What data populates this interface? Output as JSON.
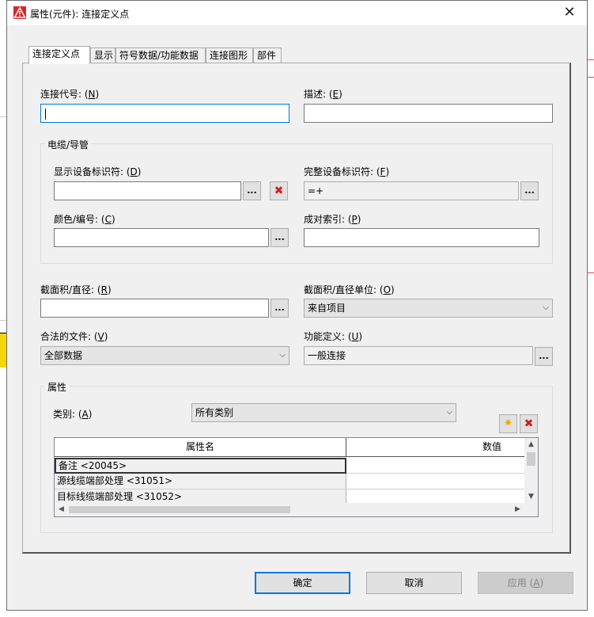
{
  "window": {
    "title": "属性(元件): 连接定义点",
    "close_glyph": "✕"
  },
  "tabs": [
    {
      "label": "连接定义点",
      "active": true
    },
    {
      "label": "显示"
    },
    {
      "label": "符号数据/功能数据"
    },
    {
      "label": "连接图形"
    },
    {
      "label": "部件"
    }
  ],
  "fields": {
    "connection_code": {
      "label": "连接代号: ",
      "key": "N",
      "value": ""
    },
    "description": {
      "label": "描述: ",
      "key": "E",
      "value": ""
    },
    "cable_group": {
      "title": "电缆/导管"
    },
    "display_id": {
      "label": "显示设备标识符: ",
      "key": "D",
      "value": ""
    },
    "full_id": {
      "label": "完整设备标识符: ",
      "key": "F",
      "value": "=+"
    },
    "color_number": {
      "label": "颜色/编号: ",
      "key": "C",
      "value": ""
    },
    "pair_index": {
      "label": "成对索引: ",
      "key": "P",
      "value": ""
    },
    "cross_section": {
      "label": "截面积/直径: ",
      "key": "R",
      "value": ""
    },
    "cross_section_unit": {
      "label": "截面积/直径单位: ",
      "key": "O",
      "value": "来自项目"
    },
    "valid_files": {
      "label": "合法的文件: ",
      "key": "V",
      "value": "全部数据"
    },
    "function_def": {
      "label": "功能定义: ",
      "key": "U",
      "value": "一般连接"
    }
  },
  "properties": {
    "title": "属性",
    "category_label": "类别: ",
    "category_key": "A",
    "category_value": "所有类别",
    "columns": [
      "属性名",
      "数值"
    ],
    "rows": [
      {
        "name": "备注 <20045>",
        "value": ""
      },
      {
        "name": "源线缆端部处理 <31051>",
        "value": ""
      },
      {
        "name": "目标线缆端部处理 <31052>",
        "value": ""
      }
    ]
  },
  "icons": {
    "app": "warning-triangle-icon",
    "ellipsis": "...",
    "delete": "✖",
    "new": "✷",
    "chevron": "⌵"
  },
  "buttons": {
    "ok": "确定",
    "cancel": "取消",
    "apply": "应用",
    "apply_key": "A"
  },
  "colors": {
    "focus": "#0078d7",
    "delete_red": "#d02020",
    "new_orange": "#f0a000"
  }
}
